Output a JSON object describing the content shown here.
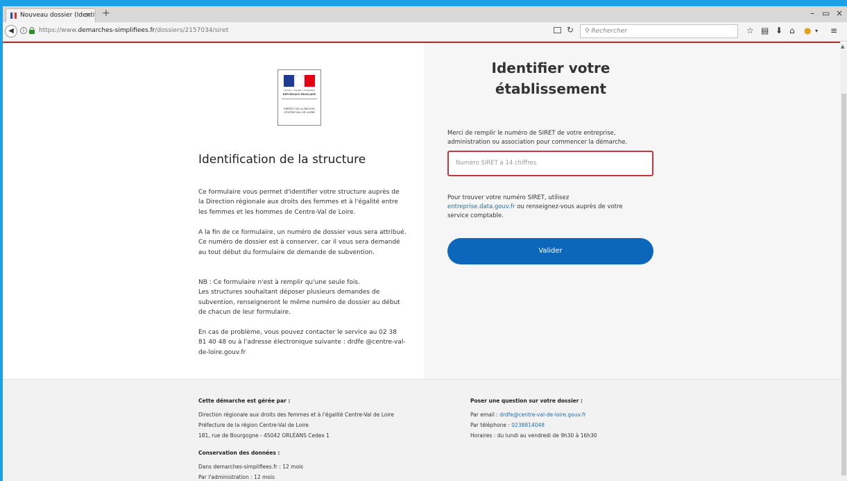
{
  "browser": {
    "tab_title": "Nouveau dossier (Identific...",
    "tab_close": "×",
    "new_tab": "+",
    "url_prefix": "https://www.",
    "url_domain": "demarches-simplifiees.fr",
    "url_path": "/dossiers/2157034/siret",
    "search_placeholder": "Rechercher",
    "win_min": "–",
    "win_max": "▭",
    "win_close": "×"
  },
  "logo": {
    "motto": "Liberté • Égalité • Fraternité",
    "republic": "RÉPUBLIQUE FRANÇAISE",
    "prefet_line1": "PRÉFET DE LA RÉGION",
    "prefet_line2": "CENTRE-VAL DE LOIRE"
  },
  "left": {
    "title": "Identification de la structure",
    "p1": "Ce formulaire vous permet d'identifier votre structure auprès de la Direction régionale aux droits des femmes et à l'égalité entre les femmes et les hommes de Centre-Val de Loire.",
    "p2a": "A la fin de ce formulaire, un numéro de dossier vous sera attribué.",
    "p2b": "Ce numéro de dossier est à conserver, car il vous sera demandé au tout début du formulaire de demande de subvention.",
    "p3a": "NB : Ce formulaire n'est à remplir qu'une seule fois.",
    "p3b": "Les structures souhaitant déposer plusieurs demandes de subvention, renseigneront le même numéro de dossier au début de chacun de leur formulaire.",
    "p4": "En cas de problème, vous pouvez contacter le service au 02 38 81 40 48 ou à l'adresse électronique suivante : drdfe @centre-val-de-loire.gouv.fr"
  },
  "right": {
    "title": "Identifier votre établissement",
    "intro1": "Merci de remplir le numéro de SIRET de votre entreprise,",
    "intro2": "administration ou association pour commencer la démarche.",
    "siret_placeholder": "Numéro SIRET à 14 chiffres",
    "help1": "Pour trouver votre numéro SIRET, utilisez",
    "help_link": "entreprise.data.gouv.fr",
    "help2": " ou renseignez-vous auprès de votre",
    "help3": "service comptable.",
    "submit": "Valider"
  },
  "footer": {
    "managed_title": "Cette démarche est gérée par :",
    "managed_1": "Direction régionale aux droits des femmes et à l'égalité Centre-Val de Loire",
    "managed_2": "Préfecture de la région Centre-Val de Loire",
    "managed_3": "181, rue de Bourgogne - 45042 ORLÉANS Cedex 1",
    "question_title": "Poser une question sur votre dossier :",
    "email_label": "Par email : ",
    "email": "drdfe@centre-val-de-loire.gouv.fr",
    "phone_label": "Par téléphone : ",
    "phone": "0238814048",
    "hours": "Horaires : du lundi au vendredi de 9h30 à 16h30",
    "conservation_title": "Conservation des données :",
    "conservation_1": "Dans demarches-simplifiees.fr : 12 mois",
    "conservation_2": "Par l'administration : 12 mois"
  },
  "colors": {
    "accent": "#0c66b9",
    "error_border": "#c8343e",
    "link": "#1e6fba",
    "window_frame": "#1da1e6"
  }
}
